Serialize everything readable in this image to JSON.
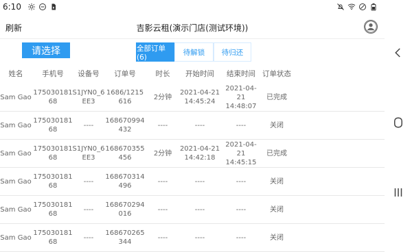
{
  "statusbar": {
    "time": "6:10",
    "left_icons": [
      "gear-icon",
      "minus-circle-icon",
      "sim-icon"
    ],
    "right_icons": [
      "bell-off-icon",
      "wifi-icon",
      "no-entry-icon",
      "battery-icon"
    ]
  },
  "header": {
    "refresh_label": "刷新",
    "title": "吉影云租(演示门店(测试环境))"
  },
  "controls": {
    "select_label": "请选择",
    "tabs": [
      {
        "label": "全部订单(6)",
        "active": true
      },
      {
        "label": "待解锁",
        "active": false
      },
      {
        "label": "待归还",
        "active": false
      }
    ]
  },
  "table": {
    "columns": [
      "姓名",
      "手机号",
      "设备号",
      "订单号",
      "时长",
      "开始时间",
      "结束时间",
      "订单状态"
    ],
    "rows": [
      {
        "name": "Sam Gao",
        "phone": "17503018168",
        "phone_lines": [
          "175030181",
          "68"
        ],
        "device": "S1JYN0_6EE3",
        "device_lines": [
          "S1JYN0_6",
          "EE3"
        ],
        "order": "1686/1215616",
        "order_lines": [
          "1686/1215",
          "616"
        ],
        "duration": "2分钟",
        "start_lines": [
          "2021-04-21",
          "14:45:24"
        ],
        "end_lines": [
          "2021-04-21",
          "14:48:07"
        ],
        "status": "已完成"
      },
      {
        "name": "Sam Gao",
        "phone": "17503018168",
        "phone_lines": [
          "175030181",
          "68"
        ],
        "device": "----",
        "device_lines": [
          "----"
        ],
        "order": "168670994432",
        "order_lines": [
          "168670994",
          "432"
        ],
        "duration": "----",
        "start_lines": [
          "----"
        ],
        "end_lines": [
          "----"
        ],
        "status": "关闭"
      },
      {
        "name": "Sam Gao",
        "phone": "17503018168",
        "phone_lines": [
          "175030181",
          "68"
        ],
        "device": "S1JYN0_6EE3",
        "device_lines": [
          "S1JYN0_6",
          "EE3"
        ],
        "order": "168670355456",
        "order_lines": [
          "168670355",
          "456"
        ],
        "duration": "2分钟",
        "start_lines": [
          "2021-04-21",
          "14:42:18"
        ],
        "end_lines": [
          "2021-04-21",
          "14:45:15"
        ],
        "status": "已完成"
      },
      {
        "name": "Sam Gao",
        "phone": "17503018168",
        "phone_lines": [
          "175030181",
          "68"
        ],
        "device": "----",
        "device_lines": [
          "----"
        ],
        "order": "168670314496",
        "order_lines": [
          "168670314",
          "496"
        ],
        "duration": "----",
        "start_lines": [
          "----"
        ],
        "end_lines": [
          "----"
        ],
        "status": "关闭"
      },
      {
        "name": "Sam Gao",
        "phone": "17503018168",
        "phone_lines": [
          "175030181",
          "68"
        ],
        "device": "----",
        "device_lines": [
          "----"
        ],
        "order": "168670294016",
        "order_lines": [
          "168670294",
          "016"
        ],
        "duration": "----",
        "start_lines": [
          "----"
        ],
        "end_lines": [
          "----"
        ],
        "status": "关闭"
      },
      {
        "name": "Sam Gao",
        "phone": "17503018168",
        "phone_lines": [
          "175030181",
          "68"
        ],
        "device": "----",
        "device_lines": [
          "----"
        ],
        "order": "168670265344",
        "order_lines": [
          "168670265",
          "344"
        ],
        "duration": "----",
        "start_lines": [
          "----"
        ],
        "end_lines": [
          "----"
        ],
        "status": "关闭"
      }
    ]
  },
  "navigation": {
    "back_icon": "back-chevron-icon",
    "home_icon": "home-circle-icon",
    "recents_icon": "recents-icon"
  },
  "colors": {
    "accent": "#2f9bf0",
    "tab_border": "#d7ebff",
    "text_muted": "#666666",
    "divider": "#e7e7e7"
  }
}
